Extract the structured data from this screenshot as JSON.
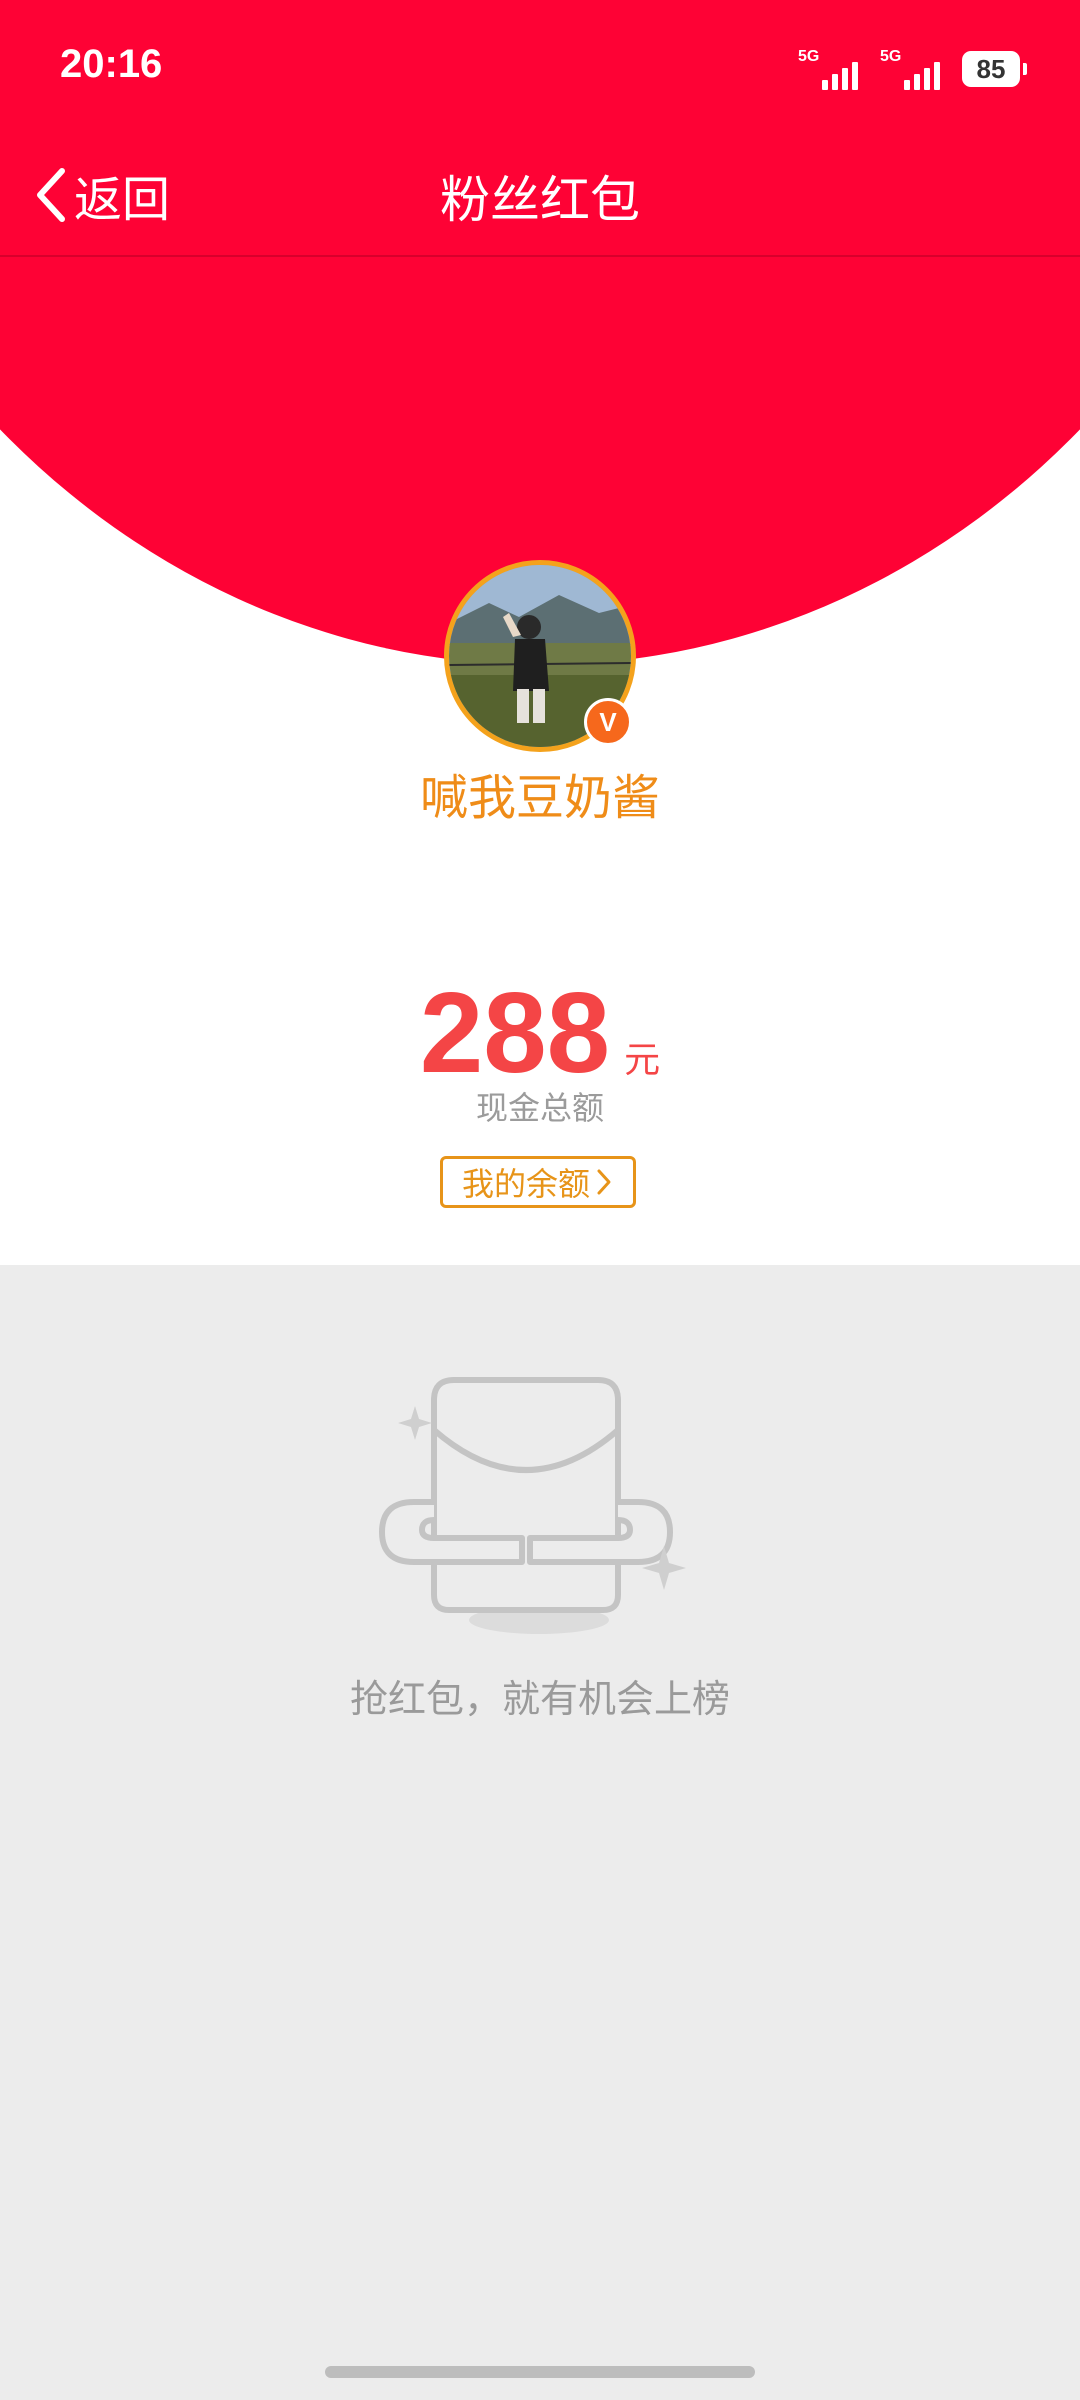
{
  "status_bar": {
    "time": "20:16",
    "signal1": "5G",
    "signal2": "5G",
    "battery": "85"
  },
  "header": {
    "back_label": "返回",
    "title": "粉丝红包"
  },
  "profile": {
    "name": "喊我豆奶酱",
    "verified_badge": "V"
  },
  "cash": {
    "amount": "288",
    "unit": "元",
    "label": "现金总额",
    "balance_button": "我的余额"
  },
  "empty_state": {
    "message": "抢红包，就有机会上榜"
  },
  "icons": [
    "chevron-left-icon",
    "signal-icon",
    "battery-icon",
    "chevron-right-icon",
    "empty-wallet-icon",
    "sparkle-icon"
  ],
  "colors": {
    "header_red": "#fe0235",
    "name_orange": "#ef8c18",
    "amount_red": "#f44546",
    "button_orange": "#e79419",
    "page_gray": "#ececec"
  }
}
